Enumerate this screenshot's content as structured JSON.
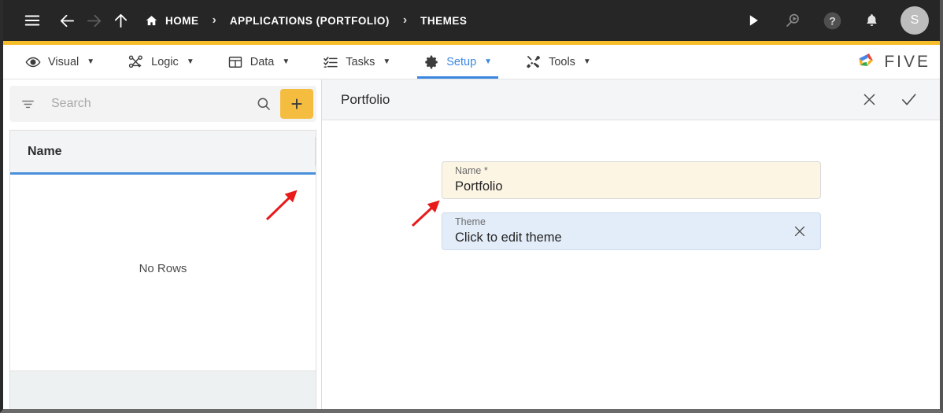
{
  "topbar": {
    "menu_icon": "hamburger-icon",
    "back_icon": "arrow-left-icon",
    "forward_icon": "arrow-right-icon",
    "up_icon": "arrow-up-icon",
    "home_icon": "home-icon",
    "breadcrumbs": [
      {
        "label": "HOME"
      },
      {
        "label": "APPLICATIONS (PORTFOLIO)"
      },
      {
        "label": "THEMES"
      }
    ],
    "separator": "›",
    "actions": [
      {
        "name": "run-icon"
      },
      {
        "name": "search-run-icon"
      },
      {
        "name": "help-icon"
      },
      {
        "name": "notifications-icon"
      }
    ],
    "avatar_initial": "S",
    "bg_color": "#262626",
    "accent_bar_color": "#f5bd2a"
  },
  "menubar": {
    "items": [
      {
        "label": "Visual",
        "icon": "eye-icon",
        "caret": "▼",
        "active": false
      },
      {
        "label": "Logic",
        "icon": "logic-nodes-icon",
        "caret": "▼",
        "active": false
      },
      {
        "label": "Data",
        "icon": "table-grid-icon",
        "caret": "▼",
        "active": false
      },
      {
        "label": "Tasks",
        "icon": "checklist-icon",
        "caret": "▼",
        "active": false
      },
      {
        "label": "Setup",
        "icon": "gear-icon",
        "caret": "▼",
        "active": true
      },
      {
        "label": "Tools",
        "icon": "wrench-screwdriver-icon",
        "caret": "▼",
        "active": false
      }
    ],
    "logo_text": "FIVE",
    "active_color": "#3b86e0"
  },
  "left_pane": {
    "search": {
      "placeholder": "Search",
      "value": "",
      "filter_icon": "filter-icon",
      "search_icon": "magnifier-icon"
    },
    "add_button": {
      "label": "+",
      "color": "#f5bd3f"
    },
    "table": {
      "columns": [
        "Name"
      ],
      "rows": [],
      "empty_message": "No Rows"
    }
  },
  "detail": {
    "title": "Portfolio",
    "close_icon": "close-x-icon",
    "confirm_icon": "check-icon",
    "fields": [
      {
        "label": "Name *",
        "value": "Portfolio",
        "bg_color": "#fdf5e4",
        "has_clear": false
      },
      {
        "label": "Theme",
        "value": "Click to edit theme",
        "bg_color": "#e3edf9",
        "has_clear": true,
        "clear_icon": "close-x-icon"
      }
    ]
  },
  "annotations": [
    {
      "name": "arrow-to-add-button",
      "color": "#e81a1a"
    },
    {
      "name": "arrow-to-theme-field",
      "color": "#e81a1a"
    }
  ]
}
